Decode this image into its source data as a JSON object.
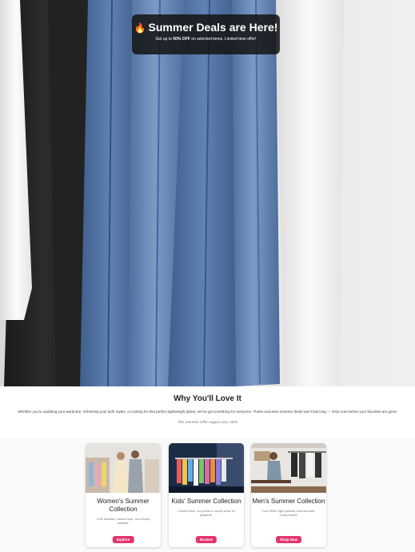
{
  "banner": {
    "icon": "fire-icon",
    "emoji": "🔥",
    "title": "Summer Deals are Here!",
    "subtitle_pre": "Get up to ",
    "subtitle_bold": "50% OFF",
    "subtitle_post": " on selected items. Limited time offer!"
  },
  "why": {
    "title": "Why You'll Love It",
    "body": "Whether you're updating your wardrobe, refreshing your kids' styles, or looking for that perfect lightweight jacket, we've got something for everyone. These exclusive summer deals won't last long — shop now before your favorites are gone!",
    "date_note": "This Summer Offer August 21st, 2025"
  },
  "cards": [
    {
      "title": "Women's Summer Collection",
      "desc": "Chic dresses, casual tops, and trendy sandals.",
      "button": "Explore"
    },
    {
      "title": "Kids' Summer Collection",
      "desc": "Colorful tees, fun prints & comfy wear for playtime.",
      "button": "Browse"
    },
    {
      "title": "Men's Summer Collection",
      "desc": "Cool tShirt, light jackets, and summer-ready shoes.",
      "button": "Shop Now"
    }
  ],
  "colors": {
    "accent": "#e2346f",
    "banner_bg": "#141414"
  }
}
